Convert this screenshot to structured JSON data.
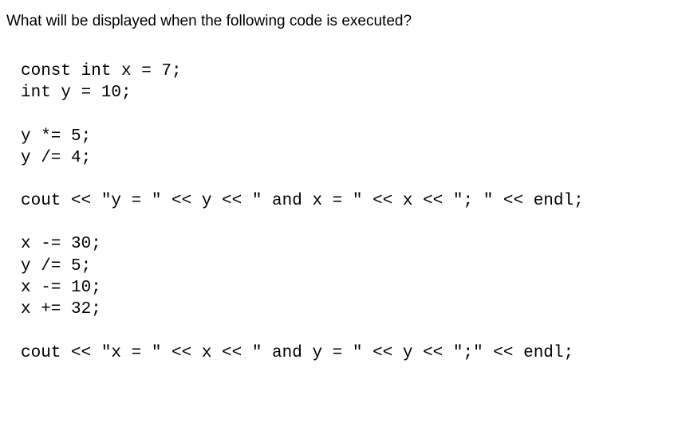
{
  "question": "What will be displayed when the following code is executed?",
  "code": {
    "lines": [
      "const int x = 7;",
      "int y = 10;",
      "",
      "y *= 5;",
      "y /= 4;",
      "",
      "cout << \"y = \" << y << \" and x = \" << x << \"; \" << endl;",
      "",
      "x -= 30;",
      "y /= 5;",
      "x -= 10;",
      "x += 32;",
      "",
      "cout << \"x = \" << x << \" and y = \" << y << \";\" << endl;"
    ]
  }
}
